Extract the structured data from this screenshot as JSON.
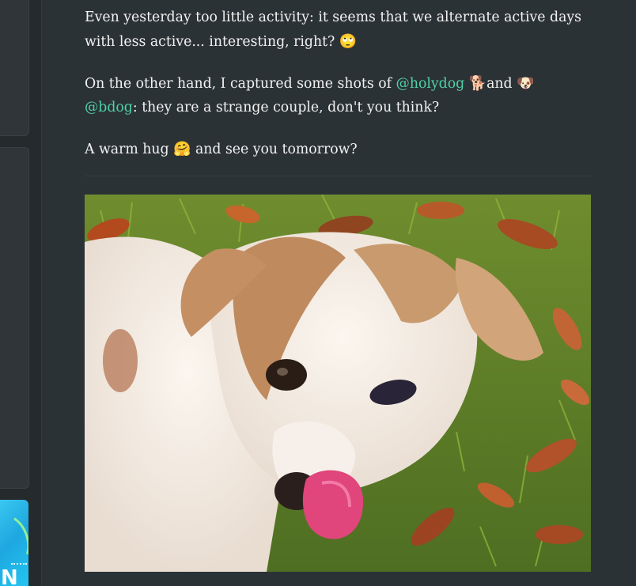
{
  "post": {
    "paragraph1": "Even yesterday too little activity: it seems that we alternate active days with less active... interesting, right?",
    "paragraph1_emoji": "🙄",
    "paragraph2_part1": "On the other hand, I captured some shots of",
    "mention1": "@holydog",
    "emoji_dog1": "🐕",
    "paragraph2_and": "and",
    "emoji_dog2": "🐶",
    "mention2": "@bdog",
    "paragraph2_part2": ": they are a strange couple, don't you think?",
    "paragraph3_part1": "A warm hug",
    "emoji_hug": "🤗",
    "paragraph3_part2": "and see you tomorrow?"
  },
  "sidebar": {
    "banner_letter": "N"
  },
  "colors": {
    "background": "#252a2d",
    "panel": "#2b3236",
    "text": "#f2f2f2",
    "mention": "#4fd1a5"
  },
  "photo": {
    "subject": "white and tan dog licking its nose on grass with autumn leaves"
  }
}
